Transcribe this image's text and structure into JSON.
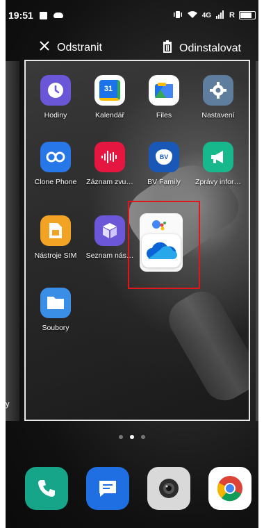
{
  "status_bar": {
    "time": "19:51",
    "network": "4G",
    "roaming": "R",
    "left_icons": [
      "gallery-icon",
      "cloud-icon"
    ],
    "right_icons": [
      "vibrate-icon",
      "wifi-icon",
      "signal-icon",
      "battery-icon"
    ]
  },
  "actions": {
    "remove_label": "Odstranit",
    "uninstall_label": "Odinstalovat"
  },
  "side_peek_text": "y",
  "apps": [
    {
      "label": "Hodiny",
      "icon": "clock-icon",
      "color": "#6a57d8"
    },
    {
      "label": "Kalendář",
      "icon": "calendar-icon",
      "color": "#ffffff",
      "badge": "31"
    },
    {
      "label": "Files",
      "icon": "files-icon",
      "color": "#ffffff"
    },
    {
      "label": "Nastavení",
      "icon": "settings-icon",
      "color": "#5f7d9c"
    },
    {
      "label": "Clone Phone",
      "icon": "clone-phone-icon",
      "color": "#2877e8"
    },
    {
      "label": "Záznam zvu…",
      "icon": "voice-recorder-icon",
      "color": "#e5163f"
    },
    {
      "label": "BV Family",
      "icon": "bv-family-icon",
      "color": "#1a58b8",
      "badge": "BV"
    },
    {
      "label": "Zprávy infor…",
      "icon": "megaphone-icon",
      "color": "#17b98c"
    },
    {
      "label": "Nástroje SIM",
      "icon": "sim-toolkit-icon",
      "color": "#f2a323"
    },
    {
      "label": "Seznam nás…",
      "icon": "cube-icon",
      "color": "#6c57d9"
    },
    {
      "label": "Soubory",
      "icon": "folder-icon",
      "color": "#3b8ee6"
    }
  ],
  "dragged_folder": {
    "icons": [
      "google-assistant-icon",
      "onedrive-icon"
    ]
  },
  "page_indicator": {
    "count": 3,
    "active": 2
  },
  "dock": [
    {
      "name": "phone-icon",
      "color": "#17a589"
    },
    {
      "name": "messages-icon",
      "color": "#1f6fe2"
    },
    {
      "name": "camera-icon",
      "color": "#d9d9d9"
    },
    {
      "name": "chrome-icon",
      "color": "#ffffff"
    }
  ]
}
